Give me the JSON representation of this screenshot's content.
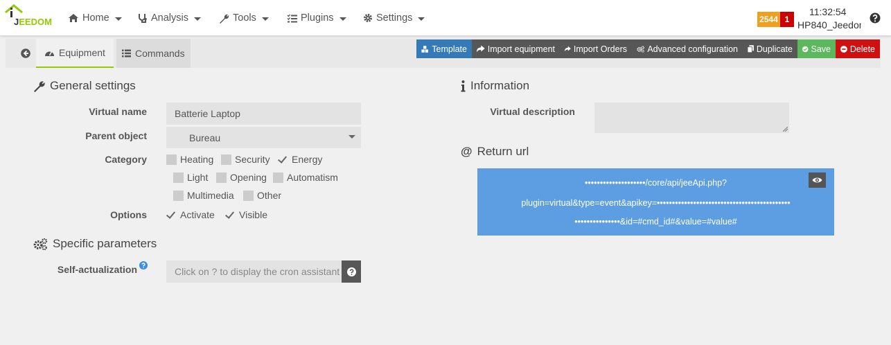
{
  "brand": {
    "logo_text_j": "J",
    "logo_text_rest": "EEDOM"
  },
  "nav": {
    "home": "Home",
    "analysis": "Analysis",
    "tools": "Tools",
    "plugins": "Plugins",
    "settings": "Settings"
  },
  "status": {
    "message_count": "2544",
    "alert_count": "1",
    "time": "11:32:54",
    "hostname": "HP840_Jeedom"
  },
  "tabs": {
    "equipment": "Equipment",
    "commands": "Commands"
  },
  "actions": {
    "template": "Template",
    "import_equipment": "Import equipment",
    "import_orders": "Import Orders",
    "advanced_configuration": "Advanced configuration",
    "duplicate": "Duplicate",
    "save": "Save",
    "delete": "Delete"
  },
  "general": {
    "title": "General settings",
    "virtual_name_label": "Virtual name",
    "virtual_name_value": "Batterie Laptop",
    "parent_object_label": "Parent object",
    "parent_object_value": "Bureau",
    "category_label": "Category",
    "categories": [
      {
        "label": "Heating",
        "checked": false
      },
      {
        "label": "Security",
        "checked": false
      },
      {
        "label": "Energy",
        "checked": true
      },
      {
        "label": "Light",
        "checked": false
      },
      {
        "label": "Opening",
        "checked": false
      },
      {
        "label": "Automatism",
        "checked": false
      },
      {
        "label": "Multimedia",
        "checked": false
      },
      {
        "label": "Other",
        "checked": false
      }
    ],
    "options_label": "Options",
    "options": [
      {
        "label": "Activate",
        "checked": true
      },
      {
        "label": "Visible",
        "checked": true
      }
    ]
  },
  "specific": {
    "title": "Specific parameters",
    "self_actualization_label": "Self-actualization",
    "self_actualization_placeholder": "Click on ? to display the cron assistant"
  },
  "information": {
    "title": "Information",
    "virtual_description_label": "Virtual description",
    "virtual_description_value": ""
  },
  "return_url": {
    "title": "Return url",
    "line1": "••••••••••••••••••••/core/api/jeeApi.php?",
    "line2": "plugin=virtual&type=event&apikey=••••••••••••••••••••••••••••••••••••••••••••",
    "line3": "•••••••••••••••&id=#cmd_id#&value=#value#"
  },
  "colors": {
    "accent_green": "#94ca02",
    "btn_blue": "#337ab7",
    "btn_dark": "#575757",
    "btn_green": "#5cb85c",
    "btn_red": "#d01010",
    "url_bg": "#5d9ee3",
    "badge_orange": "#f0a020",
    "badge_red": "#cc0000"
  }
}
